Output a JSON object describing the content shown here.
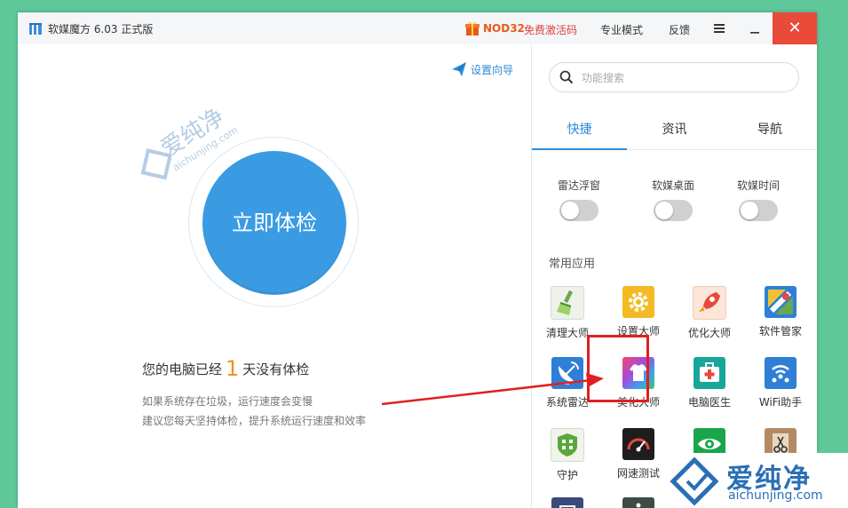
{
  "titlebar": {
    "title": "软媒魔方 6.03 正式版",
    "promo_brand": "NOD32",
    "promo_text": "免费激活码",
    "mode_link": "专业模式",
    "feedback_link": "反馈",
    "close_glyph": "✕"
  },
  "left": {
    "guide_link": "设置向导",
    "check_button": "立即体检",
    "days_prefix": "您的电脑已经",
    "days_count": "1",
    "days_suffix": "天没有体检",
    "hint_line1": "如果系统存在垃圾，运行速度会变慢",
    "hint_line2": "建议您每天坚持体检，提升系统运行速度和效率"
  },
  "right": {
    "search_placeholder": "功能搜索",
    "tabs": [
      "快捷",
      "资讯",
      "导航"
    ],
    "toggles": [
      "雷达浮窗",
      "软媒桌面",
      "软媒时间"
    ],
    "section_title": "常用应用",
    "apps": [
      {
        "label": "清理大师"
      },
      {
        "label": "设置大师"
      },
      {
        "label": "优化大师"
      },
      {
        "label": "软件管家"
      },
      {
        "label": "系统雷达"
      },
      {
        "label": "美化大师"
      },
      {
        "label": "电脑医生"
      },
      {
        "label": "WiFi助手"
      },
      {
        "label": "守护"
      },
      {
        "label": "网速测试"
      },
      {
        "label": ""
      },
      {
        "label": ""
      }
    ]
  },
  "watermark": {
    "cn": "爱纯净",
    "en": "aichunjing.com"
  },
  "colors": {
    "accent": "#2b8ad8",
    "check_button": "#3a9be3",
    "close_button": "#e94a3a",
    "highlight": "#e02020",
    "days_count": "#f39221"
  }
}
